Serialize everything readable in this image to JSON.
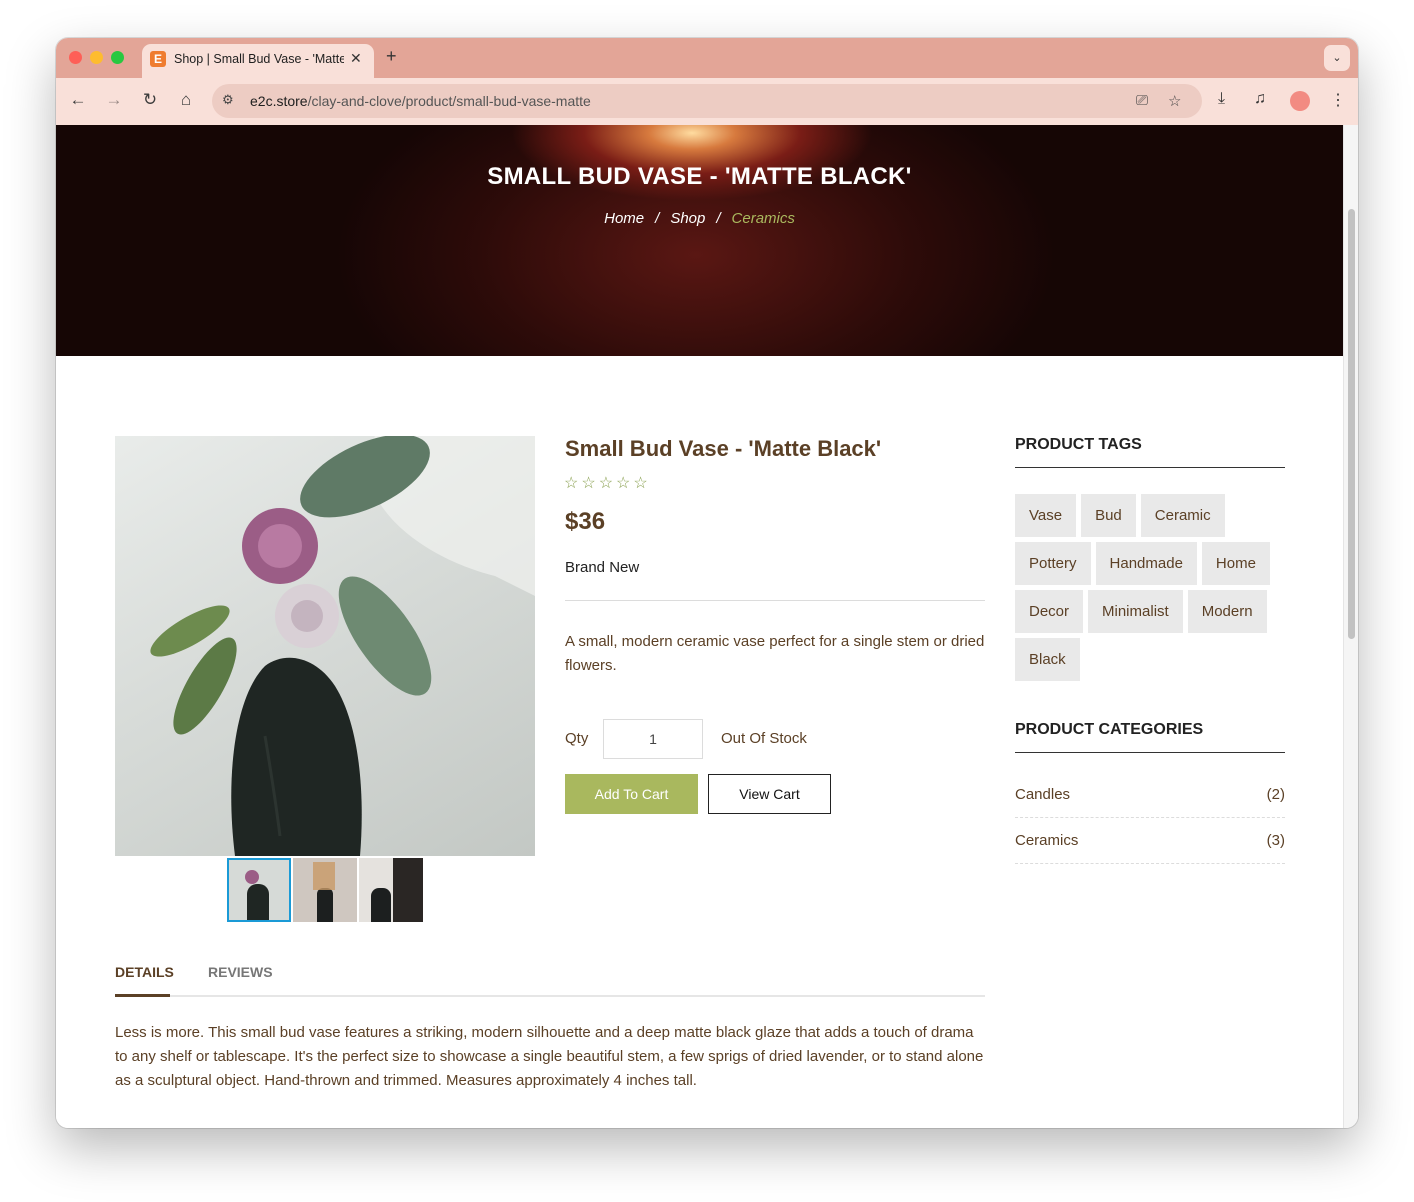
{
  "browser": {
    "tab_title": "Shop | Small Bud Vase - 'Matte Black'",
    "favicon_letter": "E",
    "url_domain": "e2c.store",
    "url_path": "/clay-and-clove/product/small-bud-vase-matte"
  },
  "hero": {
    "title": "SMALL BUD VASE - 'MATTE BLACK'",
    "breadcrumb": [
      "Home",
      "Shop",
      "Ceramics"
    ],
    "separator": "/"
  },
  "product": {
    "title": "Small Bud Vase - 'Matte Black'",
    "rating": "☆☆☆☆☆",
    "price": "$36",
    "condition": "Brand New",
    "short_description": "A small, modern ceramic vase perfect for a single stem or dried flowers.",
    "qty_label": "Qty",
    "qty_value": "1",
    "stock_status": "Out Of Stock",
    "add_to_cart": "Add To Cart",
    "view_cart": "View Cart"
  },
  "tabs": {
    "details": "DETAILS",
    "reviews": "REVIEWS",
    "details_text": "Less is more. This small bud vase features a striking, modern silhouette and a deep matte black glaze that adds a touch of drama to any shelf or tablescape. It's the perfect size to showcase a single beautiful stem, a few sprigs of dried lavender, or to stand alone as a sculptural object. Hand-thrown and trimmed. Measures approximately 4 inches tall."
  },
  "sidebar": {
    "tags_heading": "PRODUCT TAGS",
    "tags": [
      "Vase",
      "Bud",
      "Ceramic",
      "Pottery",
      "Handmade",
      "Home",
      "Decor",
      "Minimalist",
      "Modern",
      "Black"
    ],
    "categories_heading": "PRODUCT CATEGORIES",
    "categories": [
      {
        "name": "Candles",
        "count": "(2)"
      },
      {
        "name": "Ceramics",
        "count": "(3)"
      }
    ]
  },
  "colors": {
    "accent": "#a9b85e",
    "brown_text": "#5b4026",
    "tabbar": "#e3a597",
    "toolbar": "#f9e0d9"
  }
}
